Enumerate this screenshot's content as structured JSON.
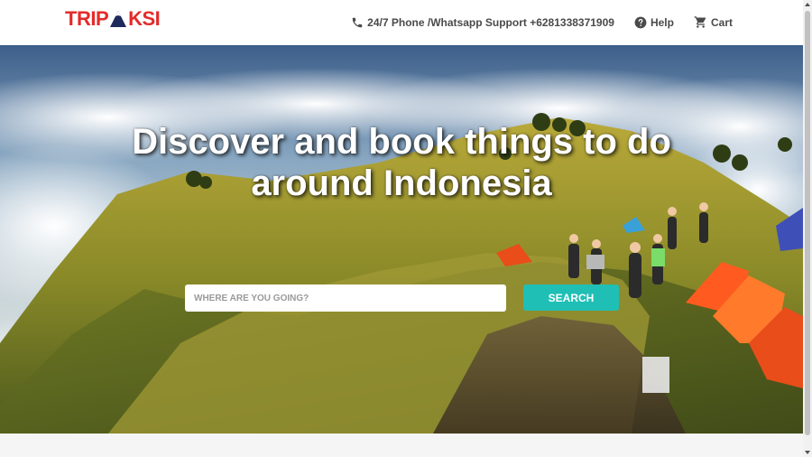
{
  "header": {
    "logo": {
      "part1": "TRIP",
      "part2": "KSI",
      "mark_icon": "mountain-icon"
    },
    "nav": [
      {
        "label": "24/7 Phone /Whatsapp Support +6281338371909",
        "icon": "phone-icon"
      },
      {
        "label": "Help",
        "icon": "help-icon"
      },
      {
        "label": "Cart",
        "icon": "cart-icon"
      }
    ]
  },
  "hero": {
    "title_line1": "Discover and book things to do",
    "title_line2": "around Indonesia",
    "search": {
      "placeholder": "WHERE ARE YOU GOING?",
      "value": ""
    },
    "search_button": "SEARCH"
  },
  "colors": {
    "brand_red": "#e32b2b",
    "logo_navy": "#1d2a5c",
    "search_button": "#1fbfb5",
    "nav_text": "#4a4a4a"
  }
}
